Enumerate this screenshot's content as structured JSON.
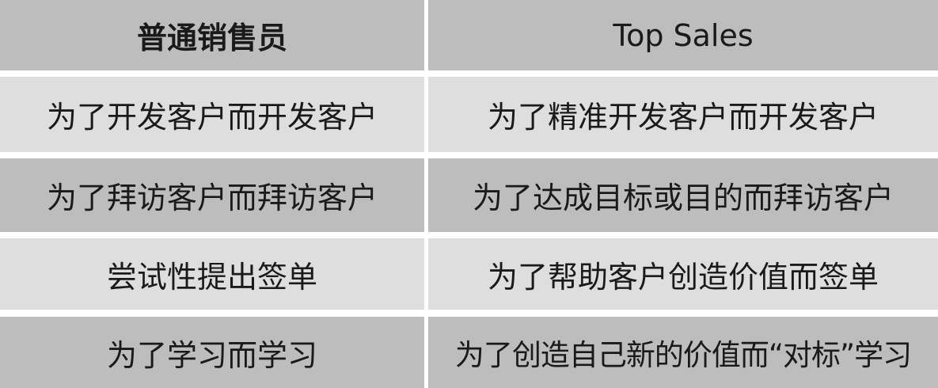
{
  "table": {
    "headers": [
      "普通销售员",
      "Top Sales"
    ],
    "rows": [
      [
        "为了开发客户而开发客户",
        "为了精准开发客户而开发客户"
      ],
      [
        "为了拜访客户而拜访客户",
        "为了达成目标或目的而拜访客户"
      ],
      [
        "尝试性提出签单",
        "为了帮助客户创造价值而签单"
      ],
      [
        "为了学习而学习",
        "为了创造自己新的价值而“对标”学习"
      ]
    ]
  }
}
